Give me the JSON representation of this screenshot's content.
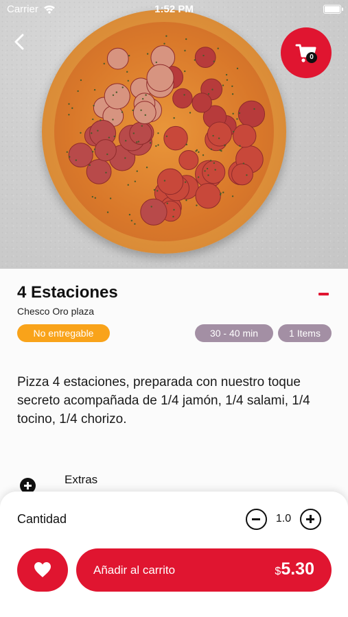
{
  "status_bar": {
    "carrier": "Carrier",
    "time": "1:52 PM"
  },
  "header": {
    "back_icon": "chevron-left-icon",
    "cart_icon": "cart-icon",
    "cart_count": "0"
  },
  "product": {
    "title": "4 Estaciones",
    "store": "Chesco Oro plaza",
    "delivery_badge": "No entregable",
    "time_badge": "30 - 40 min",
    "items_badge": "1 Items",
    "description": "Pizza 4 estaciones, preparada con nuestro toque secreto acompañada de 1/4 jamón, 1/4 salami, 1/4 tocino, 1/4 chorizo."
  },
  "extras": {
    "label": "Extras",
    "icon": "plus-circle-icon"
  },
  "order": {
    "quantity_label": "Cantidad",
    "quantity_value": "1.0",
    "add_label": "Añadir al carrito",
    "currency": "$",
    "price": "5.30"
  },
  "colors": {
    "accent": "#e01530",
    "orange_badge": "#f9a31a",
    "muted_badge": "#a38fa4"
  }
}
